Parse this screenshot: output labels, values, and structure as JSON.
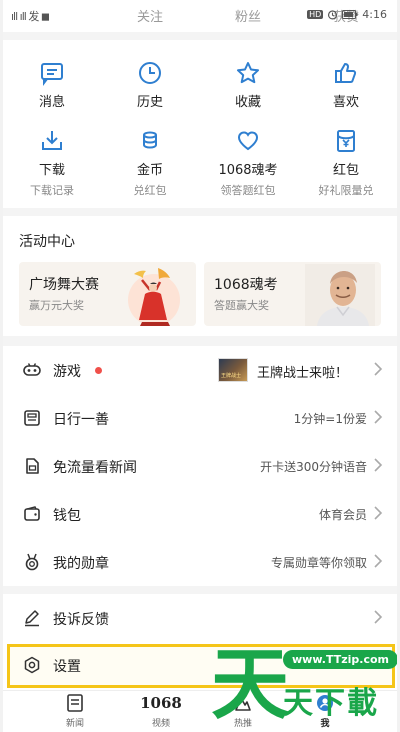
{
  "statusbar": {
    "left_text": "ıll ıll 发 ◼",
    "tabs": [
      "关注",
      "粉丝",
      "获赞"
    ],
    "right_badge": "HD",
    "time": "4:16"
  },
  "grid": [
    {
      "label": "消息",
      "sub": "",
      "icon": "message-icon"
    },
    {
      "label": "历史",
      "sub": "",
      "icon": "clock-icon"
    },
    {
      "label": "收藏",
      "sub": "",
      "icon": "star-icon"
    },
    {
      "label": "喜欢",
      "sub": "",
      "icon": "thumbs-up-icon"
    },
    {
      "label": "下载",
      "sub": "下载记录",
      "icon": "download-icon"
    },
    {
      "label": "金币",
      "sub": "兑红包",
      "icon": "coins-icon"
    },
    {
      "label": "1068魂考",
      "sub": "领答题红包",
      "icon": "heart-icon"
    },
    {
      "label": "红包",
      "sub": "好礼限量兑",
      "icon": "red-packet-icon"
    }
  ],
  "activity": {
    "title": "活动中心",
    "cards": [
      {
        "title": "广场舞大赛",
        "subtitle": "赢万元大奖",
        "art": "dancer-illustration"
      },
      {
        "title": "1068魂考",
        "subtitle": "答题赢大奖",
        "art": "host-portrait"
      }
    ]
  },
  "list": [
    {
      "label": "游戏",
      "value": "王牌战士来啦！",
      "icon": "gamepad-icon",
      "has_dot": true,
      "thumb_text": "王牌战士"
    },
    {
      "label": "日行一善",
      "value": "1分钟=1份爱",
      "icon": "charity-icon"
    },
    {
      "label": "免流量看新闻",
      "value": "开卡送300分钟语音",
      "icon": "sim-card-icon"
    },
    {
      "label": "钱包",
      "value": "体育会员",
      "icon": "wallet-icon"
    },
    {
      "label": "我的勋章",
      "value": "专属勋章等你领取",
      "icon": "medal-icon"
    }
  ],
  "list2": [
    {
      "label": "投诉反馈",
      "value": "",
      "icon": "feedback-pen-icon"
    },
    {
      "label": "设置",
      "value": "",
      "icon": "settings-icon",
      "highlighted": true
    }
  ],
  "bottomnav": [
    {
      "label": "新闻",
      "icon": "news-icon"
    },
    {
      "label": "视频",
      "icon": "video-logo-icon",
      "logo_text": "1068"
    },
    {
      "label": "热推",
      "icon": "hot-icon"
    },
    {
      "label": "我",
      "icon": "profile-icon",
      "active": true
    }
  ],
  "watermark": {
    "big": "天",
    "url": "www.TTzip.com",
    "small": "天下載"
  },
  "colors": {
    "accent": "#2f7fd0",
    "dot": "#f0504a",
    "highlight": "#f5c518",
    "watermark": "#1aa64a"
  }
}
